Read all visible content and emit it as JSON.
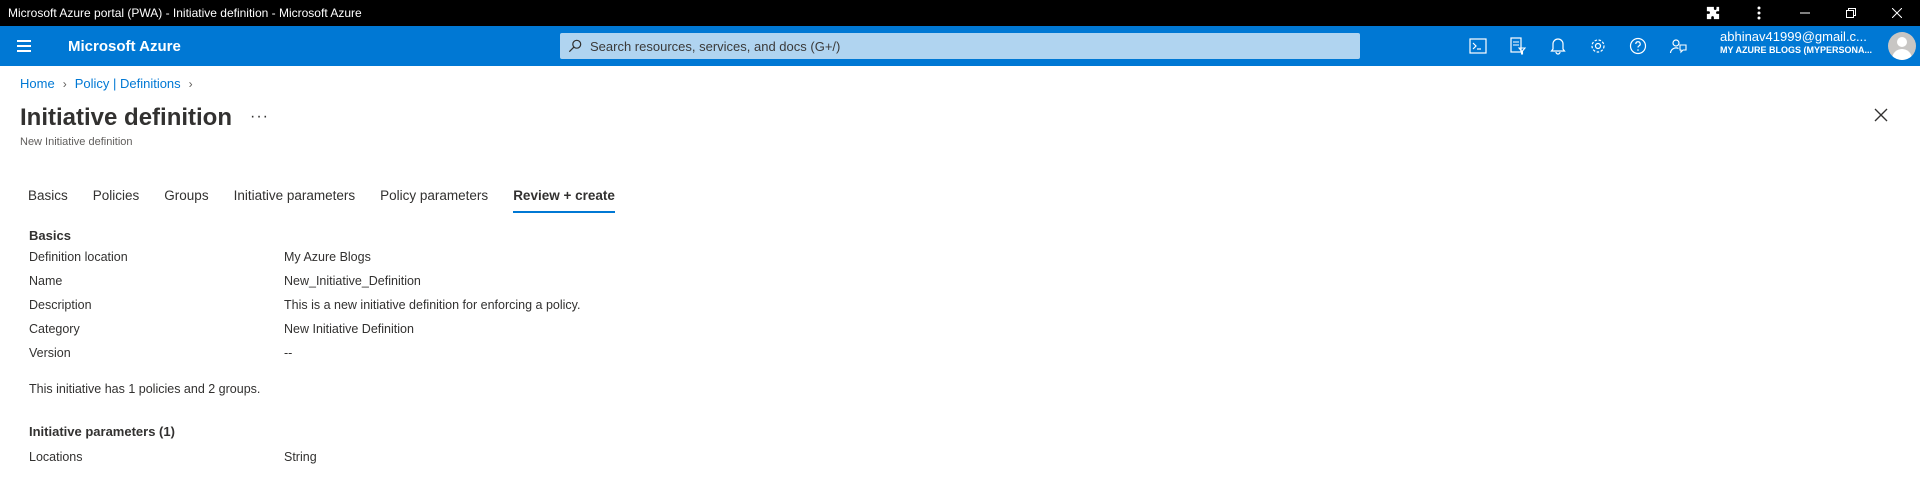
{
  "window": {
    "title": "Microsoft Azure portal (PWA) - Initiative definition - Microsoft Azure"
  },
  "topbar": {
    "brand": "Microsoft Azure",
    "search_placeholder": "Search resources, services, and docs (G+/)",
    "icons": [
      "cloud-shell-icon",
      "directory-filter-icon",
      "notifications-icon",
      "settings-icon",
      "help-icon",
      "feedback-icon"
    ],
    "account_email": "abhinav41999@gmail.c...",
    "account_directory": "MY AZURE BLOGS (MYPERSONA...",
    "accent_color": "#0078d4"
  },
  "breadcrumb": {
    "items": [
      "Home",
      "Policy | Definitions"
    ]
  },
  "header": {
    "title": "Initiative definition",
    "more": "···",
    "subtitle": "New Initiative definition"
  },
  "tabs": [
    {
      "label": "Basics",
      "active": false
    },
    {
      "label": "Policies",
      "active": false
    },
    {
      "label": "Groups",
      "active": false
    },
    {
      "label": "Initiative parameters",
      "active": false
    },
    {
      "label": "Policy parameters",
      "active": false
    },
    {
      "label": "Review + create",
      "active": true
    }
  ],
  "review": {
    "basics_heading": "Basics",
    "basics": [
      {
        "label": "Definition location",
        "value": "My Azure Blogs"
      },
      {
        "label": "Name",
        "value": "New_Initiative_Definition"
      },
      {
        "label": "Description",
        "value": "This is a new initiative definition for enforcing a policy."
      },
      {
        "label": "Category",
        "value": "New Initiative Definition"
      },
      {
        "label": "Version",
        "value": "--"
      }
    ],
    "summary_note": "This initiative has 1 policies and 2 groups.",
    "params_heading": "Initiative parameters (1)",
    "params": [
      {
        "label": "Locations",
        "value": "String"
      }
    ]
  }
}
